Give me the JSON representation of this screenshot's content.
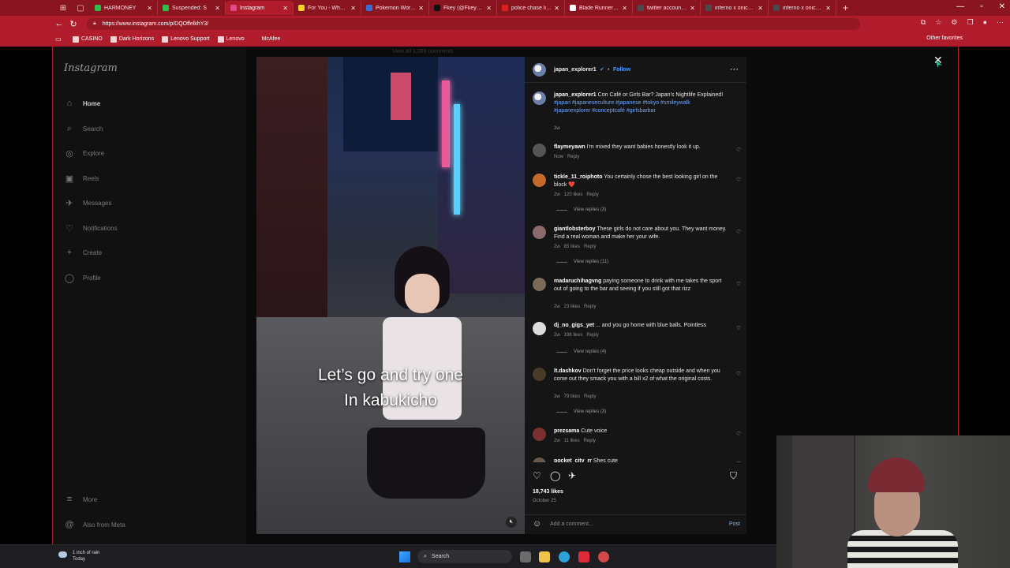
{
  "browser": {
    "tabs": [
      {
        "label": "HARMONEY",
        "color": "#2fbf4a",
        "active": false
      },
      {
        "label": "Suspended: S",
        "color": "#2fbf4a",
        "active": false
      },
      {
        "label": "Instagram",
        "color": "#e24b8a",
        "active": true
      },
      {
        "label": "For You - Whatnot",
        "color": "#f5d428",
        "active": false
      },
      {
        "label": "Pokemon World C",
        "color": "#3a6fd8",
        "active": false
      },
      {
        "label": "Fkey (@Fkeymey",
        "color": "#111111",
        "active": false
      },
      {
        "label": "police chase live",
        "color": "#e02020",
        "active": false
      },
      {
        "label": "Blade Runner 2049",
        "color": "#ffffff",
        "active": false
      },
      {
        "label": "twitter account w",
        "color": "#4a4a4a",
        "active": false
      },
      {
        "label": "inferno x onicorn",
        "color": "#4a4a4a",
        "active": false
      },
      {
        "label": "inferno x onicorn",
        "color": "#4a4a4a",
        "active": false
      }
    ],
    "url": "https://www.instagram.com/p/DQOffelkhY3/",
    "bookmarks": [
      "CASINO",
      "Dark Horizons",
      "Lenovo Support",
      "Lenovo",
      "McAfee"
    ],
    "other_favorites": "Other favorites"
  },
  "sidebar": {
    "logo": "Instagram",
    "items": [
      {
        "label": "Home",
        "icon": "home-icon"
      },
      {
        "label": "Search",
        "icon": "search-icon"
      },
      {
        "label": "Explore",
        "icon": "compass-icon"
      },
      {
        "label": "Reels",
        "icon": "reels-icon"
      },
      {
        "label": "Messages",
        "icon": "messages-icon"
      },
      {
        "label": "Notifications",
        "icon": "heart-icon"
      },
      {
        "label": "Create",
        "icon": "plus-icon"
      },
      {
        "label": "Profile",
        "icon": "avatar-icon"
      }
    ],
    "more": "More",
    "also_from_meta": "Also from Meta"
  },
  "overlay_top": "View all 1,069 comments",
  "video": {
    "caption_line1": "Let’s go and try one",
    "caption_line2": "In kabukicho"
  },
  "post": {
    "author": "japan_explorer1",
    "follow": "Follow",
    "caption_user": "japan_explorer1",
    "caption_text": "Con Café or Girls Bar? Japan’s Nightlife Explained!",
    "caption_tags": "#japan #japaneseculture #japanese #tokyo #smileywalk #japanexplorer #conceptcafé #girlsbarbar",
    "caption_time": "3w",
    "comments": [
      {
        "user": "flaymeyawn",
        "text": "I'm mixed they want babies honestly look it up.",
        "meta": "Now   Reply",
        "replies": ""
      },
      {
        "user": "tickle_11_roiphoto",
        "text": "You certainly chose the best looking girl on the block ❤️",
        "meta": "2w   120 likes   Reply",
        "replies": "View replies (3)"
      },
      {
        "user": "giantlobsterboy",
        "text": "These girls do not care about you. They want money. Find a real woman and make her your wife.",
        "meta": "2w   85 likes   Reply",
        "replies": "View replies (11)"
      },
      {
        "user": "madaruchihagvng",
        "text": "paying someone to drink with me takes the sport out of going to the bar and seeing if you still got that rizz",
        "meta": "2w   23 likes   Reply",
        "replies": ""
      },
      {
        "user": "dj_no_gigs_yet",
        "text": "... and you go home with blue balls. Pointless",
        "meta": "2w   198 likes   Reply",
        "replies": "View replies (4)"
      },
      {
        "user": "lt.dashkov",
        "text": "Don't forget the price looks cheap outside and when you come out they smack you with a bill x2 of what the original costs.",
        "meta": "3w   79 likes   Reply",
        "replies": "View replies (3)"
      },
      {
        "user": "prezsama",
        "text": "Cute voice",
        "meta": "2w   11 likes   Reply",
        "replies": ""
      },
      {
        "user": "pocket_city_rr",
        "text": "Shes cute",
        "meta": "",
        "replies": ""
      }
    ],
    "likes": "18,743 likes",
    "date": "October 25",
    "add_comment_placeholder": "Add a comment...",
    "post_label": "Post"
  },
  "taskbar": {
    "weather_line1": "1 inch of rain",
    "weather_line2": "Today",
    "search": "Search"
  }
}
